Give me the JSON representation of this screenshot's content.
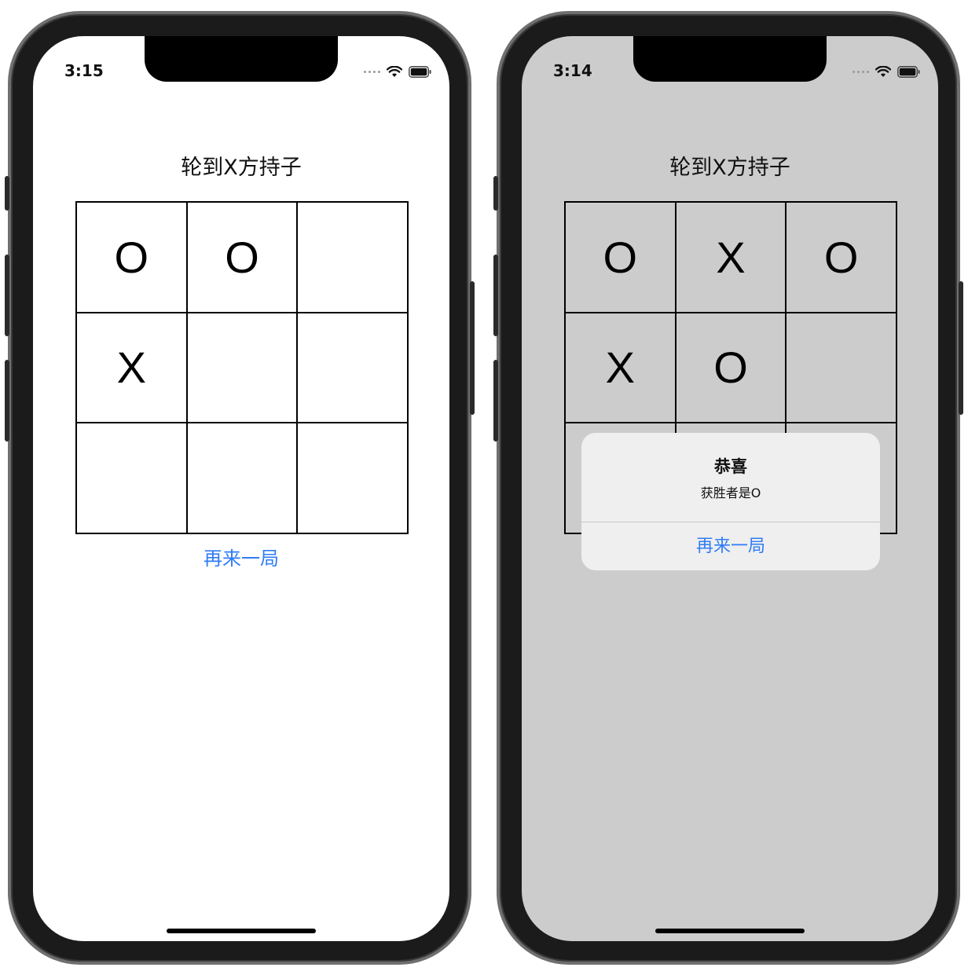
{
  "colors": {
    "accent_blue": "#2f7cf6",
    "dim_background": "#cccccc",
    "alert_background": "#efefef"
  },
  "left_phone": {
    "status": {
      "time": "3:15",
      "icons": [
        "signal-dots-icon",
        "wifi-icon",
        "battery-icon"
      ]
    },
    "title": "轮到X方持子",
    "board": [
      [
        "O",
        "O",
        ""
      ],
      [
        "X",
        "",
        ""
      ],
      [
        "",
        "",
        ""
      ]
    ],
    "restart_label": "再来一局"
  },
  "right_phone": {
    "status": {
      "time": "3:14",
      "icons": [
        "signal-dots-icon",
        "wifi-icon",
        "battery-icon"
      ]
    },
    "title": "轮到X方持子",
    "board": [
      [
        "O",
        "X",
        "O"
      ],
      [
        "X",
        "O",
        ""
      ],
      [
        "",
        "",
        ""
      ]
    ],
    "alert": {
      "title": "恭喜",
      "message": "获胜者是O",
      "button_label": "再来一局"
    }
  }
}
